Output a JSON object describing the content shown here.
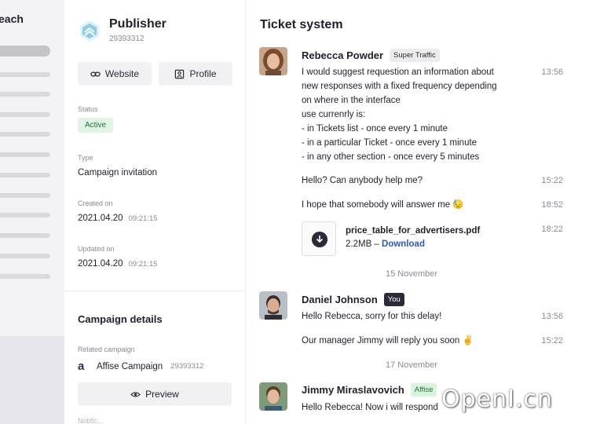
{
  "sidebar": {
    "brand_partial": "each"
  },
  "publisher": {
    "name": "Publisher",
    "id": "29393312",
    "website_button": "Website",
    "profile_button": "Profile",
    "status_label": "Status",
    "status_value": "Active",
    "type_label": "Type",
    "type_value": "Campaign invitation",
    "created_label": "Created on",
    "created_date": "2021.04.20",
    "created_time": "09:21:15",
    "updated_label": "Updated on",
    "updated_date": "2021.04.20",
    "updated_time": "09:21:15"
  },
  "campaign_details": {
    "title": "Campaign details",
    "related_label": "Related campaign",
    "campaign_name": "Affise Campaign",
    "campaign_id": "29393312",
    "preview_button": "Preview",
    "next_label_partial": "Notific..."
  },
  "chat": {
    "title": "Ticket system",
    "messages": [
      {
        "sender": "Rebecca Powder",
        "tag": "Super Traffic",
        "text": "I would suggest requestion an information about\nnew responses with a fixed frequency depending\non where in the interface\nuse currenrly is:\n- in Tickets list - once every 1 minute\n- in a particular Ticket - once every 1 minute\n- in any other section - once every 5 minutes",
        "time": "13:56"
      },
      {
        "text": "Hello? Can anybody help me?",
        "time": "15:22"
      },
      {
        "text": "I hope that somebody will answer me 😓",
        "time": "18:52"
      },
      {
        "file_name": "price_table_for_advertisers.pdf",
        "file_size": "2.2MB –",
        "download_label": "Download",
        "time": "18:22"
      }
    ],
    "day_separator_1": "15 November",
    "daniel": {
      "sender": "Daniel Johnson",
      "tag": "You",
      "messages": [
        {
          "text": "Hello Rebecca, sorry for this delay!",
          "time": "13:56"
        },
        {
          "text": "Our manager Jimmy will reply you soon ✌",
          "time": "15:22"
        }
      ]
    },
    "day_separator_2": "17 November",
    "jimmy": {
      "sender": "Jimmy Miraslavovich",
      "tag": "Affise",
      "messages": [
        {
          "text": "Hello Rebecca! Now i will respond",
          "time": ""
        }
      ]
    }
  },
  "watermark": "OpenI.cn",
  "colors": {
    "active_badge_bg": "#e1f5e4",
    "affise_tag_bg": "#d6f5da",
    "link": "#2a57c9",
    "you_tag_bg": "#2a2a38"
  }
}
